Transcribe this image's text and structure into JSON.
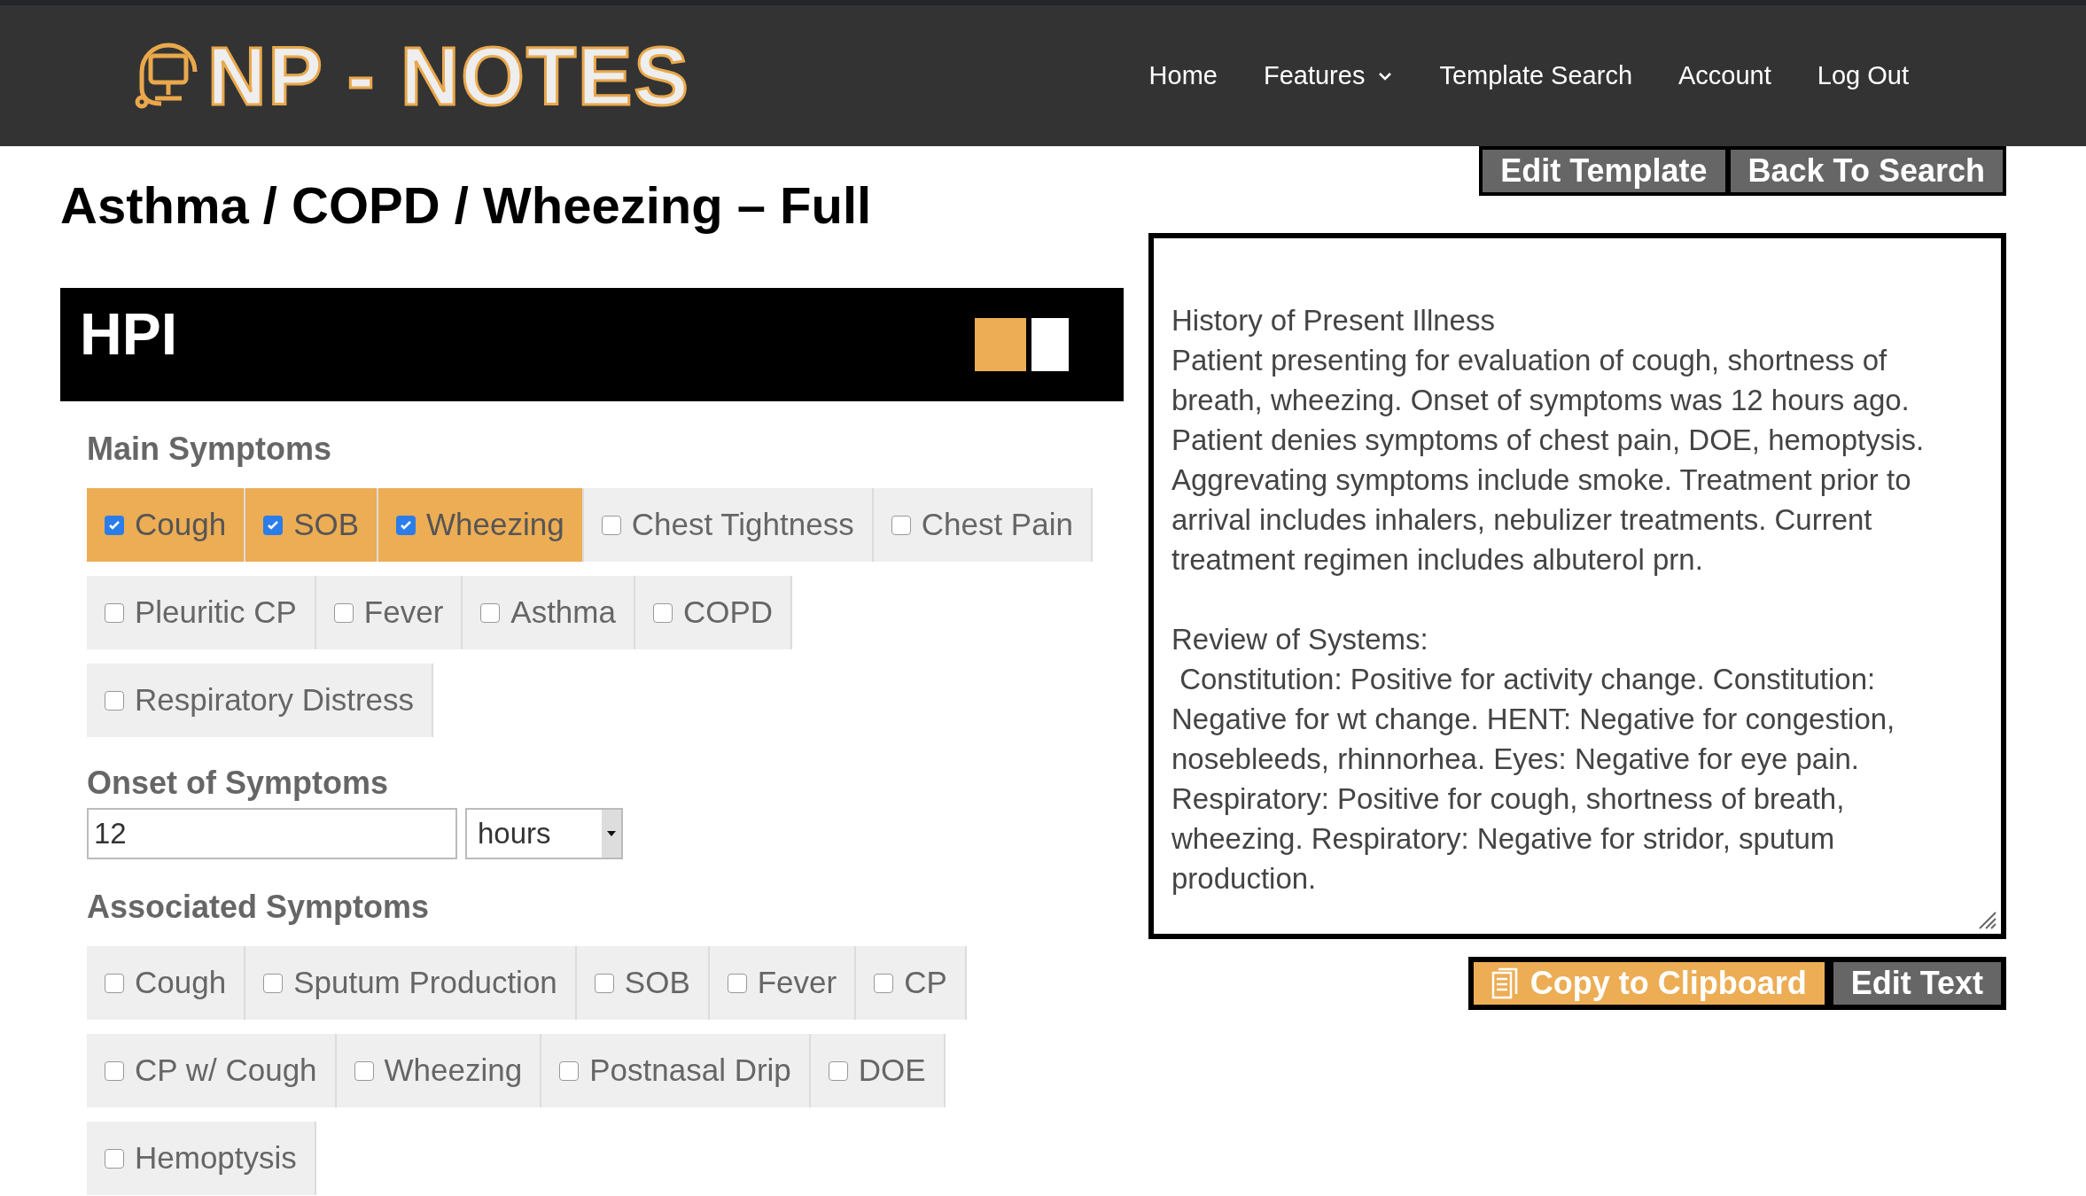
{
  "brand": {
    "name": "NP - NOTES"
  },
  "nav": [
    {
      "label": "Home",
      "dropdown": false
    },
    {
      "label": "Features",
      "dropdown": true
    },
    {
      "label": "Template Search",
      "dropdown": false
    },
    {
      "label": "Account",
      "dropdown": false
    },
    {
      "label": "Log Out",
      "dropdown": false
    }
  ],
  "page_title": "Asthma / COPD / Wheezing – Full",
  "section": {
    "title": "HPI"
  },
  "main_symptoms": {
    "heading": "Main Symptoms",
    "rows": [
      [
        {
          "label": "Cough",
          "checked": true
        },
        {
          "label": "SOB",
          "checked": true
        },
        {
          "label": "Wheezing",
          "checked": true
        },
        {
          "label": "Chest Tightness",
          "checked": false
        },
        {
          "label": "Chest Pain",
          "checked": false
        }
      ],
      [
        {
          "label": "Pleuritic CP",
          "checked": false
        },
        {
          "label": "Fever",
          "checked": false
        },
        {
          "label": "Asthma",
          "checked": false
        },
        {
          "label": "COPD",
          "checked": false
        }
      ],
      [
        {
          "label": "Respiratory Distress",
          "checked": false
        }
      ]
    ]
  },
  "onset": {
    "heading": "Onset of Symptoms",
    "value": "12",
    "unit": "hours"
  },
  "associated_symptoms": {
    "heading": "Associated Symptoms",
    "rows": [
      [
        {
          "label": "Cough",
          "checked": false
        },
        {
          "label": "Sputum Production",
          "checked": false
        },
        {
          "label": "SOB",
          "checked": false
        },
        {
          "label": "Fever",
          "checked": false
        },
        {
          "label": "CP",
          "checked": false
        }
      ],
      [
        {
          "label": "CP w/ Cough",
          "checked": false
        },
        {
          "label": "Wheezing",
          "checked": false
        },
        {
          "label": "Postnasal Drip",
          "checked": false
        },
        {
          "label": "DOE",
          "checked": false
        }
      ],
      [
        {
          "label": "Hemoptysis",
          "checked": false
        }
      ]
    ]
  },
  "top_buttons": [
    "Edit Template",
    "Back To Search"
  ],
  "note": {
    "paragraphs": [
      {
        "heading": "History of Present Illness",
        "text": "Patient presenting for evaluation of cough, shortness of breath, wheezing. Onset of symptoms was 12 hours ago. Patient denies symptoms of chest pain, DOE, hemoptysis. Aggrevating symptoms include smoke. Treatment prior to arrival includes inhalers, nebulizer treatments. Current treatment regimen includes albuterol prn."
      },
      {
        "heading": "Review of Systems:",
        "text": " Constitution: Positive for activity change. Constitution: Negative for wt change. HENT: Negative for congestion, nosebleeds, rhinnorhea. Eyes: Negative for eye pain. Respiratory: Positive for cough, shortness of breath, wheezing. Respiratory: Negative for stridor, sputum production."
      }
    ]
  },
  "note_buttons": [
    {
      "label": "Copy to Clipboard",
      "kind": "primary"
    },
    {
      "label": "Edit Text",
      "kind": "secondary"
    }
  ]
}
